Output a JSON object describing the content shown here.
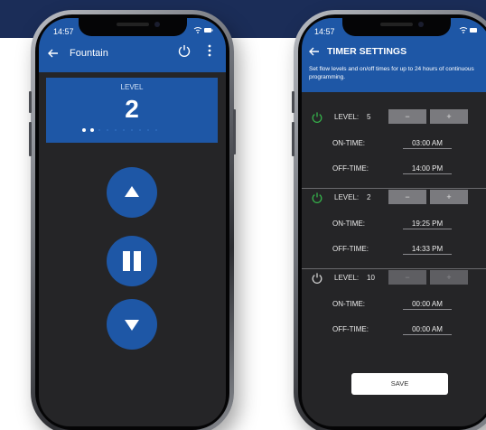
{
  "colors": {
    "banner": "#1b2d58",
    "accent_blue": "#1e57a6",
    "screen_bg": "#252527",
    "power_on": "#35b24a",
    "power_off": "#d0d0d0"
  },
  "phone_left": {
    "status": {
      "time": "14:57",
      "icons": "wifi-icon battery-icon"
    },
    "appbar": {
      "back_icon": "back-arrow-icon",
      "title": "Fountain",
      "power_icon": "power-icon",
      "menu_icon": "more-vertical-icon"
    },
    "level_card": {
      "label": "LEVEL",
      "value": "2",
      "steps_total": 10,
      "steps_active": 2
    },
    "controls": [
      {
        "name": "increase-button",
        "icon": "triangle-up-icon"
      },
      {
        "name": "pause-button",
        "icon": "pause-icon"
      },
      {
        "name": "decrease-button",
        "icon": "triangle-down-icon"
      }
    ]
  },
  "phone_right": {
    "status": {
      "time": "14:57",
      "icons": "wifi-icon battery-icon"
    },
    "header": {
      "back_icon": "back-arrow-icon",
      "title": "TIMER SETTINGS",
      "description": "Set flow levels and on/off times for up to 24 hours of continuous programming."
    },
    "timers": [
      {
        "power_state": "on",
        "level_label": "LEVEL:",
        "level_value": "5",
        "minus": "−",
        "plus": "+",
        "on_label": "ON-TIME:",
        "on_time": "03:00 AM",
        "off_label": "OFF-TIME:",
        "off_time": "14:00 PM"
      },
      {
        "power_state": "on",
        "level_label": "LEVEL:",
        "level_value": "2",
        "minus": "−",
        "plus": "+",
        "on_label": "ON-TIME:",
        "on_time": "19:25 PM",
        "off_label": "OFF-TIME:",
        "off_time": "14:33 PM"
      },
      {
        "power_state": "off",
        "level_label": "LEVEL:",
        "level_value": "10",
        "minus": "−",
        "plus": "+",
        "on_label": "ON-TIME:",
        "on_time": "00:00 AM",
        "off_label": "OFF-TIME:",
        "off_time": "00:00 AM"
      }
    ],
    "save_label": "SAVE"
  }
}
